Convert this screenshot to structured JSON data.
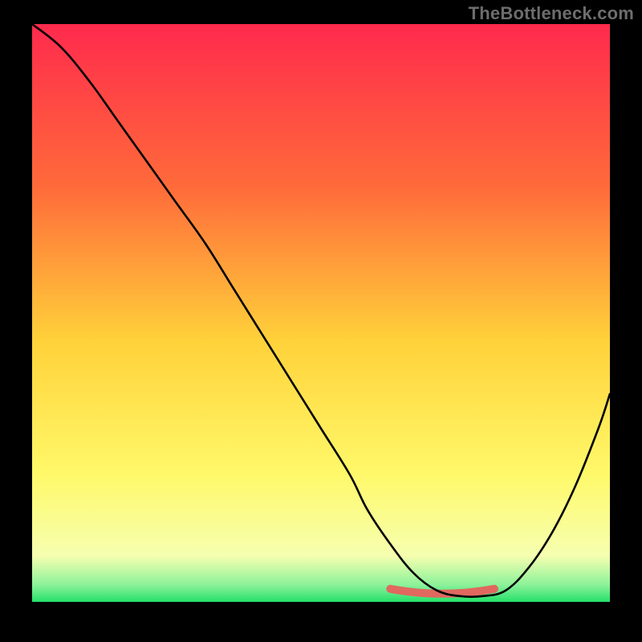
{
  "watermark": "TheBottleneck.com",
  "colors": {
    "page_bg": "#000000",
    "gradient_top": "#ff2a4d",
    "gradient_mid_upper": "#ff6a3a",
    "gradient_mid": "#ffd23a",
    "gradient_lower": "#fff96a",
    "gradient_bottom": "#25e06b",
    "curve": "#000000",
    "highlight": "#e0685f",
    "watermark_text": "#6d6d6d"
  },
  "chart_data": {
    "type": "line",
    "title": "",
    "xlabel": "",
    "ylabel": "",
    "xlim": [
      0,
      100
    ],
    "ylim": [
      0,
      100
    ],
    "series": [
      {
        "name": "bottleneck-curve",
        "x": [
          0,
          5,
          10,
          15,
          20,
          25,
          30,
          35,
          40,
          45,
          50,
          55,
          58,
          62,
          66,
          70,
          74,
          78,
          82,
          86,
          90,
          94,
          98,
          100
        ],
        "y": [
          100,
          96,
          90,
          83,
          76,
          69,
          62,
          54,
          46,
          38,
          30,
          22,
          16,
          10,
          5,
          2,
          1,
          1,
          2,
          6,
          12,
          20,
          30,
          36
        ]
      }
    ],
    "highlight_band": {
      "x_start": 62,
      "x_end": 80,
      "y": 1
    },
    "gradient_stops_pct": [
      0,
      28,
      55,
      78,
      92,
      97,
      100
    ],
    "legend": []
  }
}
